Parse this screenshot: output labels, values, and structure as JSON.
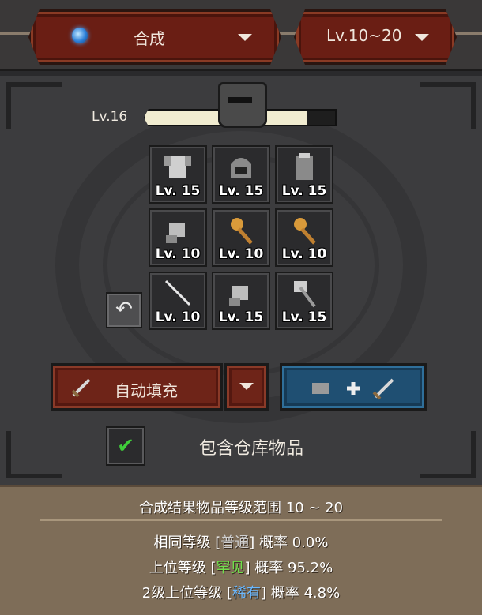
{
  "top": {
    "mode_label": "合成",
    "level_range_label": "Lv.10~20"
  },
  "progress": {
    "level_label": "Lv.16",
    "fill_fraction": 0.85
  },
  "slots": [
    {
      "level": "Lv. 15",
      "icon": "armor-icon"
    },
    {
      "level": "Lv. 15",
      "icon": "chainmail-helmet-icon"
    },
    {
      "level": "Lv. 15",
      "icon": "chainmail-armor-icon"
    },
    {
      "level": "Lv. 10",
      "icon": "gauntlet-icon"
    },
    {
      "level": "Lv. 10",
      "icon": "mace-icon"
    },
    {
      "level": "Lv. 10",
      "icon": "mace-icon"
    },
    {
      "level": "Lv. 10",
      "icon": "staff-icon"
    },
    {
      "level": "Lv. 15",
      "icon": "gauntlet-icon"
    },
    {
      "level": "Lv. 15",
      "icon": "axe-icon"
    }
  ],
  "buttons": {
    "autofill_label": "自动填充",
    "combine_icon": "combine-icon"
  },
  "checkbox": {
    "label": "包含仓库物品",
    "checked": true
  },
  "info": {
    "range_text": "合成结果物品等级范围 10 ~ 20",
    "same_prefix": "相同等级 [",
    "same_grade": "普通",
    "same_suffix": "] 概率 0.0%",
    "up_prefix": "上位等级 [",
    "up_grade": "罕见",
    "up_suffix": "] 概率 95.2%",
    "up2_prefix": "2级上位等级 [",
    "up2_grade": "稀有",
    "up2_suffix": "] 概率 4.8%"
  },
  "colors": {
    "common": "#cfcfcf",
    "uncommon": "#6fe04a",
    "rare": "#6ab8ff"
  }
}
